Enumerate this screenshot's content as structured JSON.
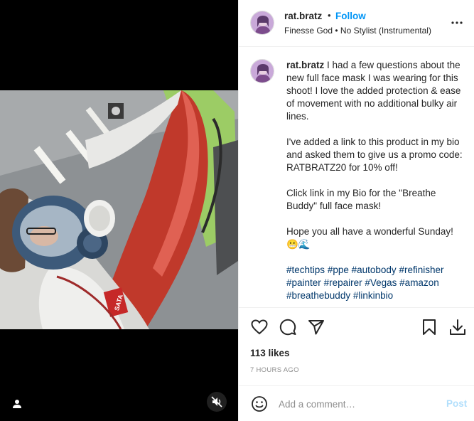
{
  "post": {
    "username": "rat.bratz",
    "dot": "•",
    "follow_label": "Follow",
    "audio": "Finesse God • No Stylist (Instrumental)"
  },
  "caption": {
    "username": "rat.bratz",
    "paragraphs": [
      "I had a few questions about the new full face mask I was wearing for this shoot! I love the added protection & ease of movement with no additional bulky air lines.",
      "I've added a link to this product in my bio and asked them to give us a promo code: RATBRATZ20 for 10% off!",
      "Click link in my Bio for the \"Breathe Buddy\" full face mask!",
      "Hope you all have a wonderful Sunday! 😬🌊"
    ],
    "hashtags": [
      "#techtips",
      "#ppe",
      "#autobody",
      "#refinisher",
      "#painter",
      "#repairer",
      "#Vegas",
      "#amazon",
      "#breathebuddy",
      "#linkinbio"
    ]
  },
  "stats": {
    "likes": "113 likes",
    "time_ago": "7 HOURS AGO"
  },
  "comment": {
    "placeholder": "Add a comment…",
    "post_label": "Post"
  },
  "photo": {
    "brand_text": "SATA"
  },
  "icons": {
    "like": "heart-icon",
    "comment": "comment-bubble-icon",
    "share": "paper-plane-icon",
    "save": "bookmark-icon",
    "download": "download-icon",
    "more": "more-dots-icon",
    "emoji": "smiley-icon",
    "tag": "user-tag-icon",
    "mute": "muted-speaker-icon"
  },
  "colors": {
    "accent": "#0095f6",
    "post_disabled": "#b2dffc",
    "hashtag": "#00376b",
    "muted_text": "#8e8e8e",
    "car_red": "#c0392b"
  }
}
